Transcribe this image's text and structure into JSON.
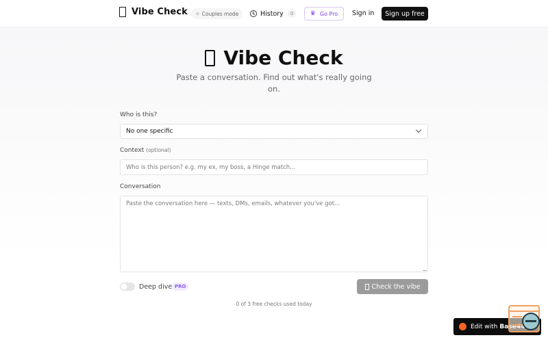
{
  "header": {
    "brand": "Vibe Check",
    "couples_mode": "Couples mode",
    "history_label": "History",
    "history_count": "0",
    "go_pro": "Go Pro",
    "sign_in": "Sign in",
    "sign_up": "Sign up free"
  },
  "hero": {
    "title": "Vibe Check",
    "subtitle": "Paste a conversation. Find out what's really going on."
  },
  "form": {
    "who_label": "Who is this?",
    "who_value": "No one specific",
    "context_label": "Context",
    "context_optional": "(optional)",
    "context_placeholder": "Who is this person? e.g. my ex, my boss, a Hinge match...",
    "conversation_label": "Conversation",
    "conversation_placeholder": "Paste the conversation here — texts, DMs, emails, whatever you've got...",
    "deep_dive_label": "Deep dive",
    "deep_dive_enabled": false,
    "pro_badge": "PRO",
    "submit_label": "Check the vibe",
    "usage_text": "0 of 3 free checks used today"
  },
  "floating": {
    "edit_label": "Edit with",
    "edit_brand": "Base44"
  },
  "icons": {
    "brand": "vibe-glyph-icon",
    "couples": "sparkle-icon",
    "history": "clock-icon",
    "pro": "crown-icon",
    "select": "chevron-down-icon",
    "submit": "vibe-glyph-icon",
    "edit": "base44-logo-icon",
    "devtool": "devtools-icon"
  },
  "colors": {
    "primary": "#111111",
    "pro_accent": "#7c3aed",
    "submit_disabled": "#9b9b9b",
    "edit_dot": "#f26522"
  }
}
